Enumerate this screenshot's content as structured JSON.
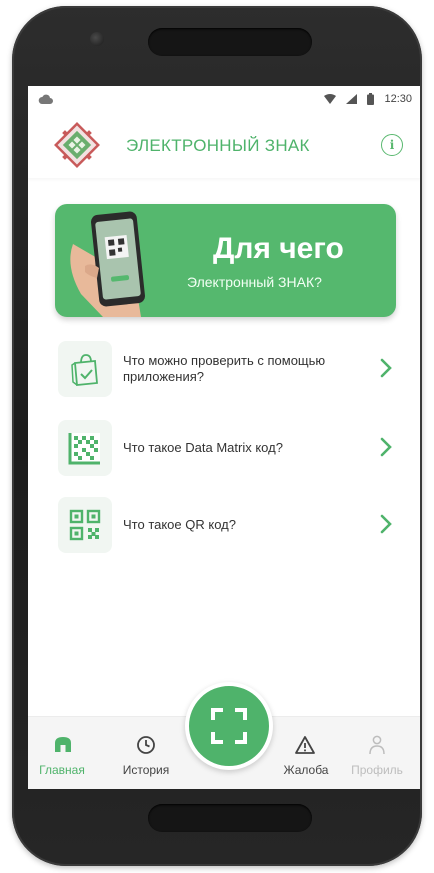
{
  "status_bar": {
    "time": "12:30"
  },
  "app_bar": {
    "title": "ЭЛЕКТРОННЫЙ ЗНАК"
  },
  "banner": {
    "title": "Для чего",
    "subtitle": "Электронный ЗНАК?"
  },
  "list": [
    {
      "label": "Что можно проверить с помощью приложения?",
      "icon": "shopping-bag-check-icon"
    },
    {
      "label": "Что такое Data Matrix код?",
      "icon": "data-matrix-icon"
    },
    {
      "label": "Что такое QR код?",
      "icon": "qr-code-icon"
    }
  ],
  "bottom_nav": {
    "items": [
      {
        "label": "Главная",
        "icon": "home-icon",
        "active": true
      },
      {
        "label": "История",
        "icon": "clock-icon",
        "active": false
      },
      {
        "label": "Жалоба",
        "icon": "warning-icon",
        "active": false
      },
      {
        "label": "Профиль",
        "icon": "user-icon",
        "active": false
      }
    ]
  },
  "colors": {
    "accent": "#4fb36b",
    "banner": "#55b86e",
    "inactive": "#bdbdbd"
  }
}
